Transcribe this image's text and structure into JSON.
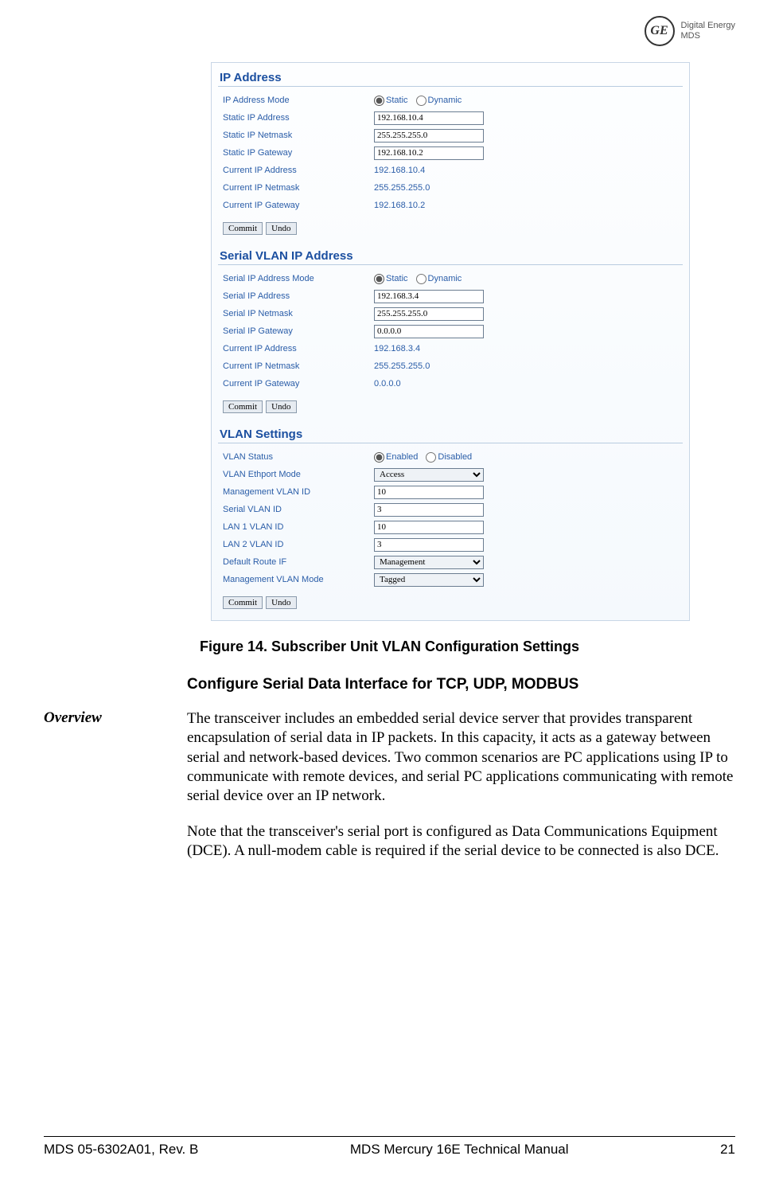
{
  "brand": {
    "tag1": "Digital Energy",
    "tag2": "MDS",
    "logo": "GE"
  },
  "screenshot": {
    "panels": [
      {
        "title": "IP Address",
        "rows": [
          {
            "label": "IP Address Mode",
            "type": "radio",
            "opts": [
              "Static",
              "Dynamic"
            ],
            "sel": 0
          },
          {
            "label": "Static IP Address",
            "type": "text",
            "value": "192.168.10.4"
          },
          {
            "label": "Static IP Netmask",
            "type": "text",
            "value": "255.255.255.0"
          },
          {
            "label": "Static IP Gateway",
            "type": "text",
            "value": "192.168.10.2"
          },
          {
            "label": "Current IP Address",
            "type": "static",
            "value": "192.168.10.4"
          },
          {
            "label": "Current IP Netmask",
            "type": "static",
            "value": "255.255.255.0"
          },
          {
            "label": "Current IP Gateway",
            "type": "static",
            "value": "192.168.10.2"
          }
        ],
        "buttons": [
          "Commit",
          "Undo"
        ]
      },
      {
        "title": "Serial VLAN IP Address",
        "rows": [
          {
            "label": "Serial IP Address Mode",
            "type": "radio",
            "opts": [
              "Static",
              "Dynamic"
            ],
            "sel": 0
          },
          {
            "label": "Serial IP Address",
            "type": "text",
            "value": "192.168.3.4"
          },
          {
            "label": "Serial IP Netmask",
            "type": "text",
            "value": "255.255.255.0"
          },
          {
            "label": "Serial IP Gateway",
            "type": "text",
            "value": "0.0.0.0"
          },
          {
            "label": "Current IP Address",
            "type": "static",
            "value": "192.168.3.4"
          },
          {
            "label": "Current IP Netmask",
            "type": "static",
            "value": "255.255.255.0"
          },
          {
            "label": "Current IP Gateway",
            "type": "static",
            "value": "0.0.0.0"
          }
        ],
        "buttons": [
          "Commit",
          "Undo"
        ]
      },
      {
        "title": "VLAN Settings",
        "rows": [
          {
            "label": "VLAN Status",
            "type": "radio",
            "opts": [
              "Enabled",
              "Disabled"
            ],
            "sel": 0
          },
          {
            "label": "VLAN Ethport Mode",
            "type": "select",
            "value": "Access"
          },
          {
            "label": "Management VLAN ID",
            "type": "text",
            "value": "10"
          },
          {
            "label": "Serial VLAN ID",
            "type": "text",
            "value": "3"
          },
          {
            "label": "LAN 1 VLAN ID",
            "type": "text",
            "value": "10"
          },
          {
            "label": "LAN 2 VLAN ID",
            "type": "text",
            "value": "3"
          },
          {
            "label": "Default Route IF",
            "type": "select",
            "value": "Management"
          },
          {
            "label": "Management VLAN Mode",
            "type": "select",
            "value": "Tagged"
          }
        ],
        "buttons": [
          "Commit",
          "Undo"
        ]
      }
    ]
  },
  "figure_caption": "Figure 14. Subscriber Unit VLAN Configuration Settings",
  "section_heading": "Configure Serial Data Interface for TCP, UDP, MODBUS",
  "side_label": "Overview",
  "para1": "The transceiver includes an embedded serial device server that provides transparent encapsulation of serial data in IP packets. In this capacity, it acts as a gateway between serial and network-based devices. Two common scenarios are PC applications using IP to communicate with remote devices, and serial PC applications communicating with remote serial device over an IP network.",
  "para2": "Note that the transceiver's serial port is configured as Data Communications Equipment (DCE). A null-modem cable is required if the serial device to be connected is also DCE.",
  "footer": {
    "left": "MDS 05-6302A01, Rev.  B",
    "center": "MDS Mercury 16E Technical Manual",
    "right": "21"
  }
}
